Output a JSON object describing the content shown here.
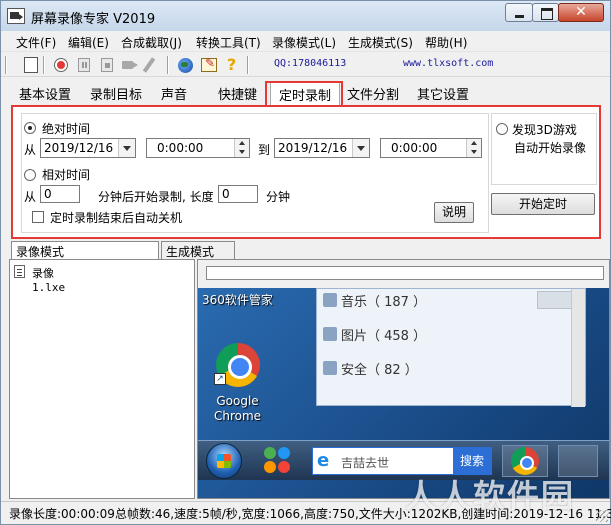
{
  "window": {
    "title": "屏幕录像专家 V2019"
  },
  "menu": {
    "items": [
      "文件(F)",
      "编辑(E)",
      "合成截取(J)",
      "转换工具(T)",
      "录像模式(L)",
      "生成模式(S)",
      "帮助(H)"
    ]
  },
  "toolbar": {
    "icons": [
      "new-icon",
      "record-icon",
      "pause-icon",
      "stop-icon",
      "camera-icon",
      "pen-icon",
      "globe-icon",
      "register-icon",
      "help-icon"
    ],
    "qq": "QQ:178046113",
    "url": "www.tlxsoft.com"
  },
  "tabs": {
    "items": [
      "基本设置",
      "录制目标",
      "声音",
      "快捷键",
      "定时录制",
      "文件分割",
      "其它设置"
    ],
    "active": "定时录制"
  },
  "schedule": {
    "absolute_label": "绝对时间",
    "from_label": "从",
    "to_label": "到",
    "start_date": "2019/12/16",
    "start_time": "0:00:00",
    "end_date": "2019/12/16",
    "end_time": "0:00:00",
    "relative_label": "相对时间",
    "relative_from": "从",
    "relative_minutes": "0",
    "relative_mid": "分钟后开始录制, 长度",
    "relative_length": "0",
    "relative_unit": "分钟",
    "shutdown_label": "定时录制结束后自动关机",
    "explain_button": "说明",
    "detect_3d_line1": "发现3D游戏",
    "detect_3d_line2": "自动开始录像",
    "start_button": "开始定时"
  },
  "bottom_tabs": {
    "record_mode": "录像模式",
    "generate_mode": "生成模式"
  },
  "file_list": {
    "items": [
      "录像1.lxe"
    ]
  },
  "preview": {
    "desktop_label": "360软件管家",
    "chrome_label_1": "Google",
    "chrome_label_2": "Chrome",
    "inner_rows": [
      "音乐（ 187 ）",
      "图片（ 458 ）",
      "安全（ 82 ）"
    ],
    "search_placeholder": "吉喆去世",
    "search_button": "搜索"
  },
  "status": {
    "text": "录像长度:00:00:09总帧数:46,速度:5帧/秒,宽度:1066,高度:750,文件大小:1202KB,创建时间:2019-12-16 11:3"
  },
  "watermark": {
    "text": "人人软件园"
  }
}
